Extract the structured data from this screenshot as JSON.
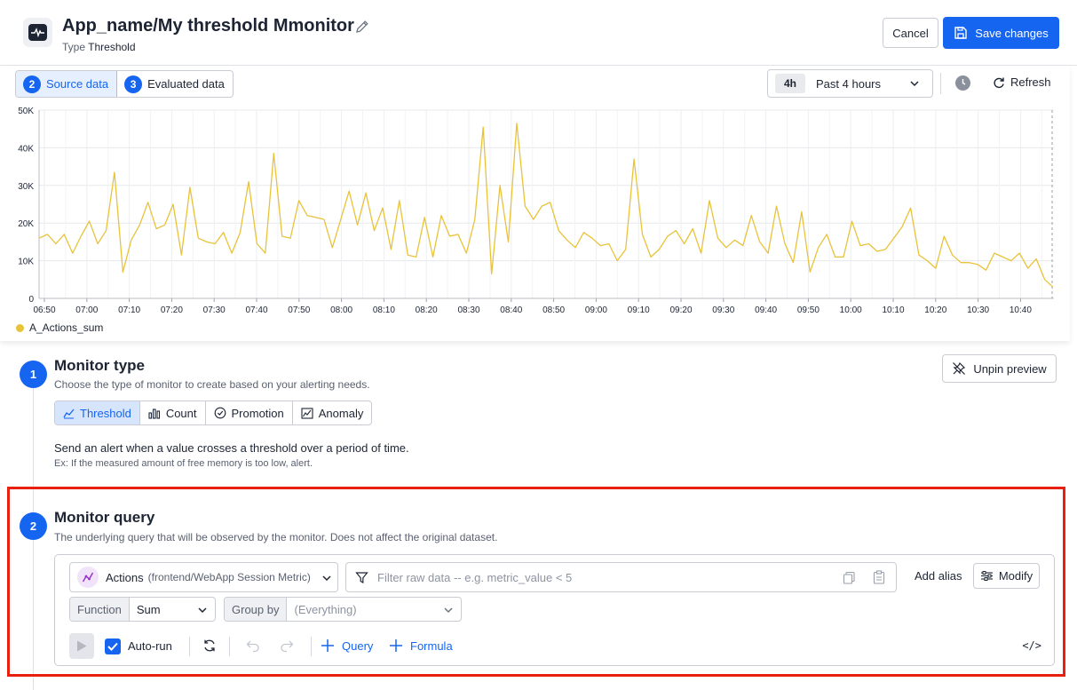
{
  "header": {
    "title": "App_name/My threshold Mmonitor",
    "type_prefix": "Type",
    "type_value": "Threshold",
    "cancel_label": "Cancel",
    "save_label": "Save changes"
  },
  "preview": {
    "tabs": [
      {
        "number": "2",
        "label": "Source data",
        "active": true
      },
      {
        "number": "3",
        "label": "Evaluated data",
        "active": false
      }
    ],
    "time_chip": "4h",
    "time_label": "Past 4 hours",
    "refresh_label": "Refresh"
  },
  "chart_data": {
    "type": "line",
    "ylim": [
      0,
      50000
    ],
    "yticks": [
      "0",
      "10K",
      "20K",
      "30K",
      "40K",
      "50K"
    ],
    "xticks": [
      "06:50",
      "07:00",
      "07:10",
      "07:20",
      "07:30",
      "07:40",
      "07:50",
      "08:00",
      "08:10",
      "08:20",
      "08:30",
      "08:40",
      "08:50",
      "09:00",
      "09:10",
      "09:20",
      "09:30",
      "09:40",
      "09:50",
      "10:00",
      "10:10",
      "10:20",
      "10:30",
      "10:40"
    ],
    "series": [
      {
        "name": "A_Actions_sum",
        "color": "#e8c33a",
        "values": [
          16000,
          17000,
          14500,
          17000,
          12000,
          16500,
          20500,
          14500,
          18000,
          33500,
          7000,
          15500,
          19500,
          25500,
          18500,
          19500,
          25000,
          11500,
          29500,
          16000,
          15000,
          14500,
          17500,
          12000,
          17500,
          31000,
          14500,
          12000,
          38500,
          16500,
          16000,
          26000,
          22000,
          21500,
          21000,
          13500,
          21000,
          28500,
          19500,
          28000,
          18000,
          24000,
          13000,
          26000,
          11500,
          11000,
          21500,
          11000,
          22000,
          16500,
          17000,
          12000,
          21000,
          45500,
          6500,
          30000,
          15000,
          46500,
          24500,
          21000,
          24500,
          25500,
          18000,
          15500,
          13500,
          17500,
          16000,
          14000,
          14500,
          10000,
          13000,
          37000,
          17000,
          11000,
          13000,
          16500,
          18000,
          14500,
          18500,
          12000,
          26000,
          16000,
          13500,
          15500,
          14000,
          22000,
          15000,
          12000,
          24500,
          14500,
          9500,
          23000,
          7000,
          13500,
          17000,
          11000,
          11000,
          20500,
          14000,
          14500,
          12500,
          13000,
          16000,
          19000,
          24000,
          11500,
          10000,
          8000,
          16500,
          11500,
          9500,
          9500,
          9000,
          7500,
          12000,
          11000,
          10000,
          12000,
          8000,
          10500,
          5000,
          3000
        ]
      }
    ]
  },
  "monitor_type": {
    "step": "1",
    "title": "Monitor type",
    "description": "Choose the type of monitor to create based on your alerting needs.",
    "unpin_label": "Unpin preview",
    "options": [
      {
        "label": "Threshold",
        "icon": "threshold-icon",
        "active": true
      },
      {
        "label": "Count",
        "icon": "count-icon",
        "active": false
      },
      {
        "label": "Promotion",
        "icon": "promotion-icon",
        "active": false
      },
      {
        "label": "Anomaly",
        "icon": "anomaly-icon",
        "active": false
      }
    ],
    "alert_description": "Send an alert when a value crosses a threshold over a period of time.",
    "example": "Ex: If the measured amount of free memory is too low, alert."
  },
  "monitor_query": {
    "step": "2",
    "title": "Monitor query",
    "description": "The underlying query that will be observed by the monitor. Does not affect the original dataset.",
    "metric_name": "Actions",
    "metric_source": "(frontend/WebApp Session Metric)",
    "filter_placeholder": "Filter raw data -- e.g. metric_value < 5",
    "add_alias_label": "Add alias",
    "modify_label": "Modify",
    "function_label": "Function",
    "function_value": "Sum",
    "group_by_label": "Group by",
    "group_by_value": "(Everything)",
    "autorun_label": "Auto-run",
    "autorun_checked": true,
    "add_query_label": "Query",
    "add_formula_label": "Formula",
    "code_label": "</>"
  }
}
